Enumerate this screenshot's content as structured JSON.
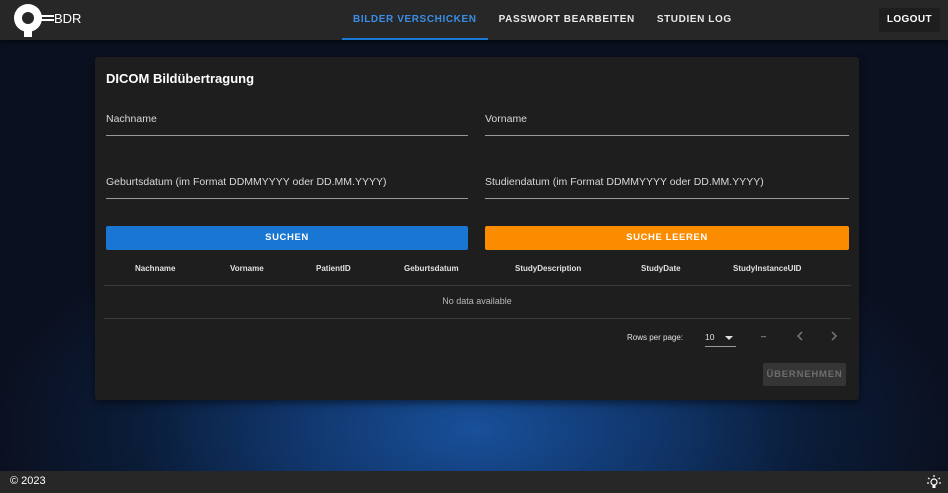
{
  "brand": {
    "text": "BDR"
  },
  "nav": {
    "tabs": [
      {
        "label": "BILDER VERSCHICKEN",
        "active": true
      },
      {
        "label": "PASSWORT BEARBEITEN",
        "active": false
      },
      {
        "label": "STUDIEN LOG",
        "active": false
      }
    ],
    "logout_label": "LOGOUT"
  },
  "card": {
    "title": "DICOM Bildübertragung",
    "fields": {
      "nachname": "Nachname",
      "vorname": "Vorname",
      "geburtsdatum": "Geburtsdatum (im Format DDMMYYYY oder DD.MM.YYYY)",
      "studiendatum": "Studiendatum (im Format DDMMYYYY oder DD.MM.YYYY)"
    },
    "buttons": {
      "search": "SUCHEN",
      "clear": "SUCHE LEEREN",
      "apply": "ÜBERNEHMEN"
    },
    "table": {
      "headers": [
        "Nachname",
        "Vorname",
        "PatientID",
        "Geburtsdatum",
        "StudyDescription",
        "StudyDate",
        "StudyInstanceUID"
      ],
      "empty_text": "No data available"
    },
    "pagination": {
      "rows_per_page_label": "Rows per page:",
      "rows_per_page": "10",
      "range": "–"
    }
  },
  "footer": {
    "copyright": "© 2023"
  },
  "colors": {
    "primary": "#1976d2",
    "accent": "#fb8c00",
    "surface": "#1e1e1e",
    "appbar": "#272727"
  }
}
